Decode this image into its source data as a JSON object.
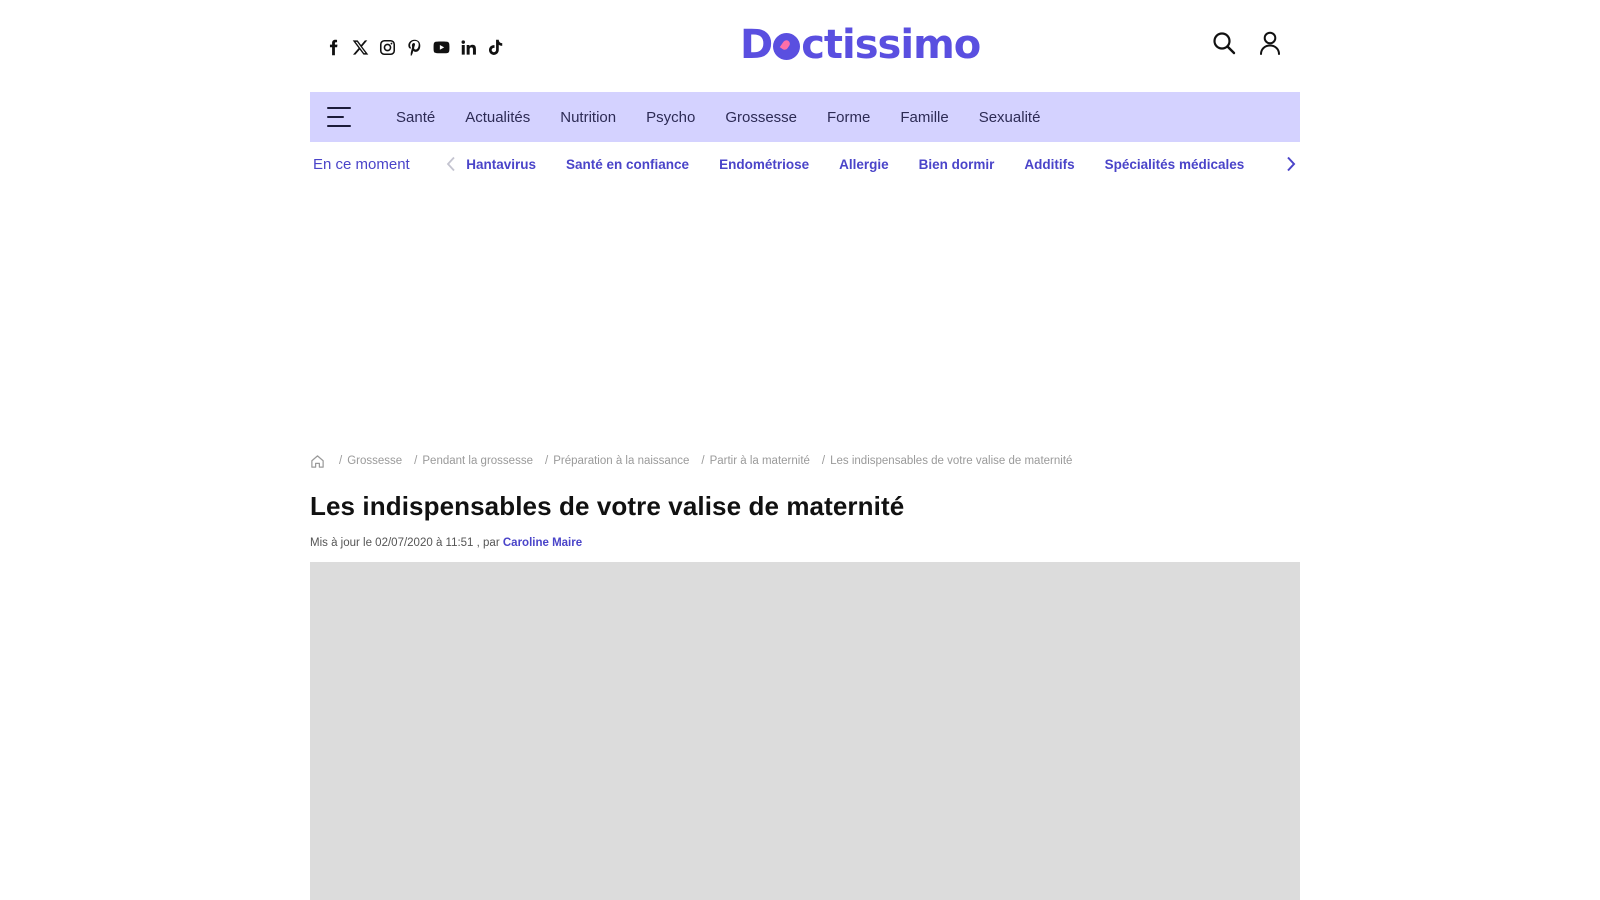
{
  "header": {
    "socials": [
      {
        "name": "facebook-icon"
      },
      {
        "name": "x-icon"
      },
      {
        "name": "instagram-icon"
      },
      {
        "name": "pinterest-icon"
      },
      {
        "name": "youtube-icon"
      },
      {
        "name": "linkedin-icon"
      },
      {
        "name": "tiktok-icon"
      }
    ],
    "logo_prefix": "D",
    "logo_suffix": "ctissimo",
    "actions": [
      "search-icon",
      "user-icon"
    ]
  },
  "nav": {
    "items": [
      "Santé",
      "Actualités",
      "Nutrition",
      "Psycho",
      "Grossesse",
      "Forme",
      "Famille",
      "Sexualité"
    ]
  },
  "trending": {
    "label": "En ce moment",
    "items": [
      "Hantavirus",
      "Santé en confiance",
      "Endométriose",
      "Allergie",
      "Bien dormir",
      "Additifs",
      "Spécialités médicales"
    ]
  },
  "breadcrumb": {
    "items": [
      "Grossesse",
      "Pendant la grossesse",
      "Préparation à la naissance",
      "Partir à la maternité"
    ],
    "current": "Les indispensables de votre valise de maternité"
  },
  "article": {
    "title": "Les indispensables de votre valise de maternité",
    "meta_prefix": "Mis à jour le 02/07/2020 à 11:51 , par",
    "author": "Caroline Maire"
  },
  "colors": {
    "brand": "#5a4fe0",
    "nav_bg": "#d4d2ff",
    "link": "#4a44c9",
    "placeholder": "#dcdcdc"
  }
}
